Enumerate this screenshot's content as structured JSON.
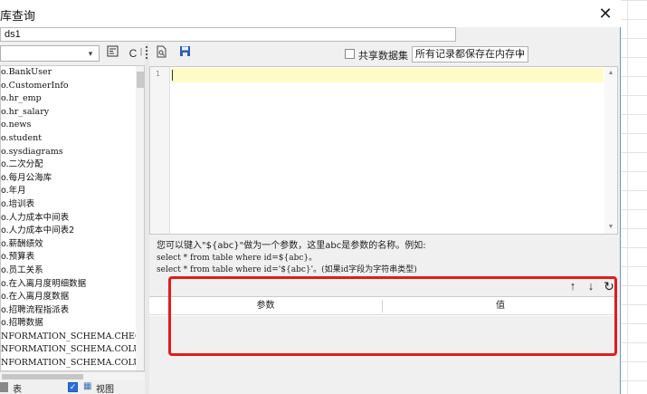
{
  "window": {
    "title": "库查询",
    "close_icon": "close-icon"
  },
  "query_name": {
    "value": "ds1"
  },
  "left_panel": {
    "connection_select": {
      "value": ""
    },
    "tables": [
      {
        "label": "o.BankUser",
        "cjk": false
      },
      {
        "label": "o.CustomerInfo",
        "cjk": false
      },
      {
        "label": "o.hr_emp",
        "cjk": false
      },
      {
        "label": "o.hr_salary",
        "cjk": false
      },
      {
        "label": "o.news",
        "cjk": false
      },
      {
        "label": "o.student",
        "cjk": false
      },
      {
        "label": "o.sysdiagrams",
        "cjk": false
      },
      {
        "label": "o.二次分配",
        "cjk": true
      },
      {
        "label": "o.每月公海库",
        "cjk": true
      },
      {
        "label": "o.年月",
        "cjk": true
      },
      {
        "label": "o.培训表",
        "cjk": true
      },
      {
        "label": "o.人力成本中间表",
        "cjk": true
      },
      {
        "label": "o.人力成本中间表2",
        "cjk": true
      },
      {
        "label": "o.薪酬绩效",
        "cjk": true
      },
      {
        "label": "o.预算表",
        "cjk": true
      },
      {
        "label": "o.员工关系",
        "cjk": true
      },
      {
        "label": "o.在入离月度明细数据",
        "cjk": true
      },
      {
        "label": "o.在入离月度数据",
        "cjk": true
      },
      {
        "label": "o.招聘流程指派表",
        "cjk": true
      },
      {
        "label": "o.招聘数据",
        "cjk": true
      },
      {
        "label": "NFORMATION_SCHEMA.CHECK_CONSTRAI",
        "cjk": false
      },
      {
        "label": "NFORMATION_SCHEMA.COLUMN_DOMAIN_",
        "cjk": false
      },
      {
        "label": "NFORMATION_SCHEMA.COLUMN_PRIVILE",
        "cjk": false
      }
    ],
    "filter_table_label": "表",
    "filter_view_label": "视图"
  },
  "toolbar": {
    "share_dataset_label": "共享数据集",
    "storage_mode_value": "所有记录都保存在内存中"
  },
  "editor": {
    "line_number": "1",
    "content": ""
  },
  "help": {
    "line1": "您可以键入\"${abc}\"做为一个参数，这里abc是参数的名称。例如:",
    "line2": "select * from table where id=${abc}。",
    "line3": "select * from table where id='${abc}'。(如果id字段为字符串类型)"
  },
  "params": {
    "col_param": "参数",
    "col_value": "值",
    "up_icon": "↑",
    "down_icon": "↓",
    "refresh_icon": "↻"
  },
  "colors": {
    "highlight_box": "#e31b1b",
    "active_line": "#fffbc6",
    "checkbox_on": "#2b6fd6"
  }
}
